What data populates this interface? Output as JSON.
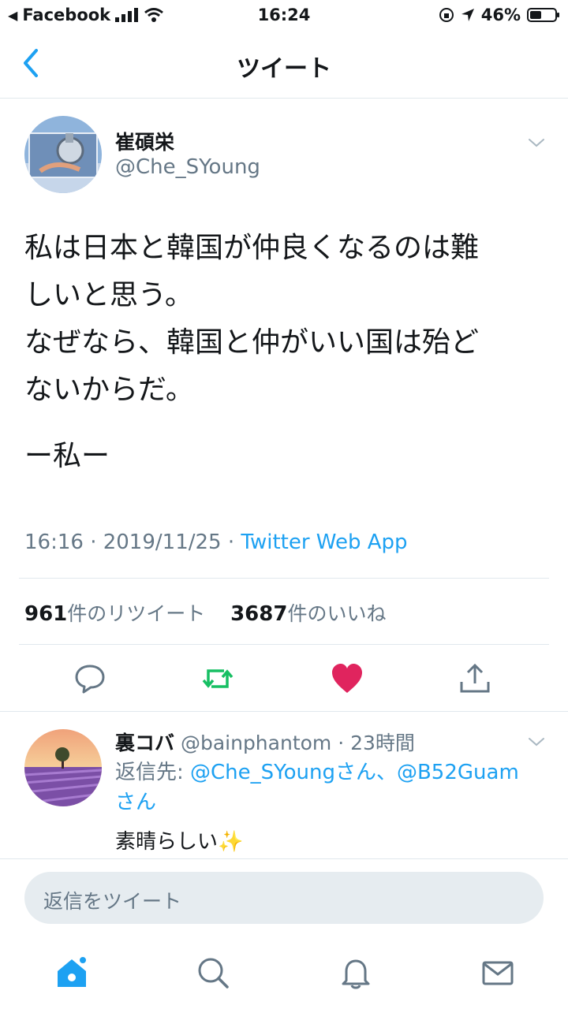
{
  "status_bar": {
    "back_app": "Facebook",
    "time": "16:24",
    "battery": "46%",
    "battery_level": 0.46
  },
  "nav": {
    "title": "ツイート"
  },
  "tweet": {
    "author_name": "崔碩栄",
    "author_handle": "@Che_SYoung",
    "lines": [
      "私は日本と韓国が仲良くなるのは難",
      "しいと思う。",
      "なぜなら、韓国と仲がいい国は殆ど",
      "ないからだ。"
    ],
    "signature": "ー私ー",
    "timestamp": "16:16 · 2019/11/25 · ",
    "source": "Twitter Web App",
    "retweet_count": "961",
    "retweet_label": "件のリツイート",
    "like_count": "3687",
    "like_label": "件のいいね"
  },
  "reply": {
    "name": "裏コバ",
    "handle_time": " @bainphantom · 23時間",
    "reply_to_label": "返信先: ",
    "mention1": "@Che_SYoungさん、@B52Guam",
    "mention2": "さん",
    "text": "素晴らしい✨"
  },
  "compose": {
    "placeholder": "返信をツイート"
  },
  "colors": {
    "accent": "#1da1f2",
    "retweet": "#17bf63",
    "like": "#e0245e",
    "muted": "#657786"
  }
}
